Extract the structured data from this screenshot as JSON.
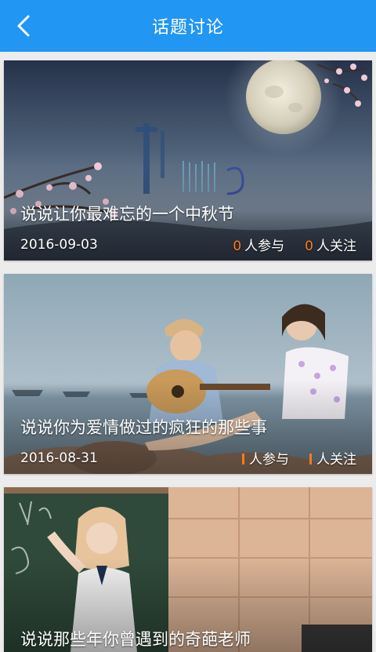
{
  "header": {
    "title": "话题讨论",
    "back_icon": "chevron-left-icon"
  },
  "colors": {
    "header_bg": "#2196f3",
    "count_accent": "#ff7a1a"
  },
  "topics": [
    {
      "title": "说说让你最难忘的一个中秋节",
      "date": "2016-09-03",
      "participants": "0",
      "participants_label": "人参与",
      "followers": "0",
      "followers_label": "人关注",
      "image": "mid-autumn-moon-blossom"
    },
    {
      "title": "说说你为爱情做过的疯狂的那些事",
      "date": "2016-08-31",
      "participants": "",
      "participants_label": "人参与",
      "followers": "",
      "followers_label": "人关注",
      "image": "couple-guitar-seaside"
    },
    {
      "title": "说说那些年你曾遇到的奇葩老师",
      "image": "teacher-blackboard"
    }
  ]
}
